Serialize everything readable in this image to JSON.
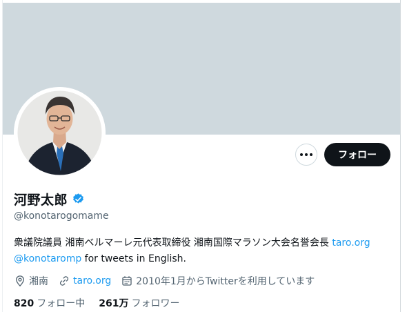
{
  "profile": {
    "name": "河野太郎",
    "handle": "@konotarogomame",
    "bio_text": "衆議院議員 湘南ベルマーレ元代表取締役 湘南国際マラソン大会名誉会長",
    "bio_link": "taro.org",
    "bio_mention": "@konotaromp",
    "bio_suffix": " for tweets in English.",
    "location": "湘南",
    "website": "taro.org",
    "joined": "2010年1月からTwitterを利用しています",
    "following_count": "820",
    "following_label": "フォロー中",
    "followers_count": "261万",
    "followers_label": "フォロワー"
  },
  "actions": {
    "follow_label": "フォロー",
    "more_icon": "more-icon"
  },
  "icons": {
    "verified": "verified-badge-icon",
    "location": "location-icon",
    "link": "link-icon",
    "calendar": "calendar-icon"
  },
  "colors": {
    "banner": "#cfd9de",
    "accent": "#1d9bf0",
    "primary_text": "#0f1419",
    "secondary_text": "#536471",
    "follow_button": "#0f1419"
  }
}
